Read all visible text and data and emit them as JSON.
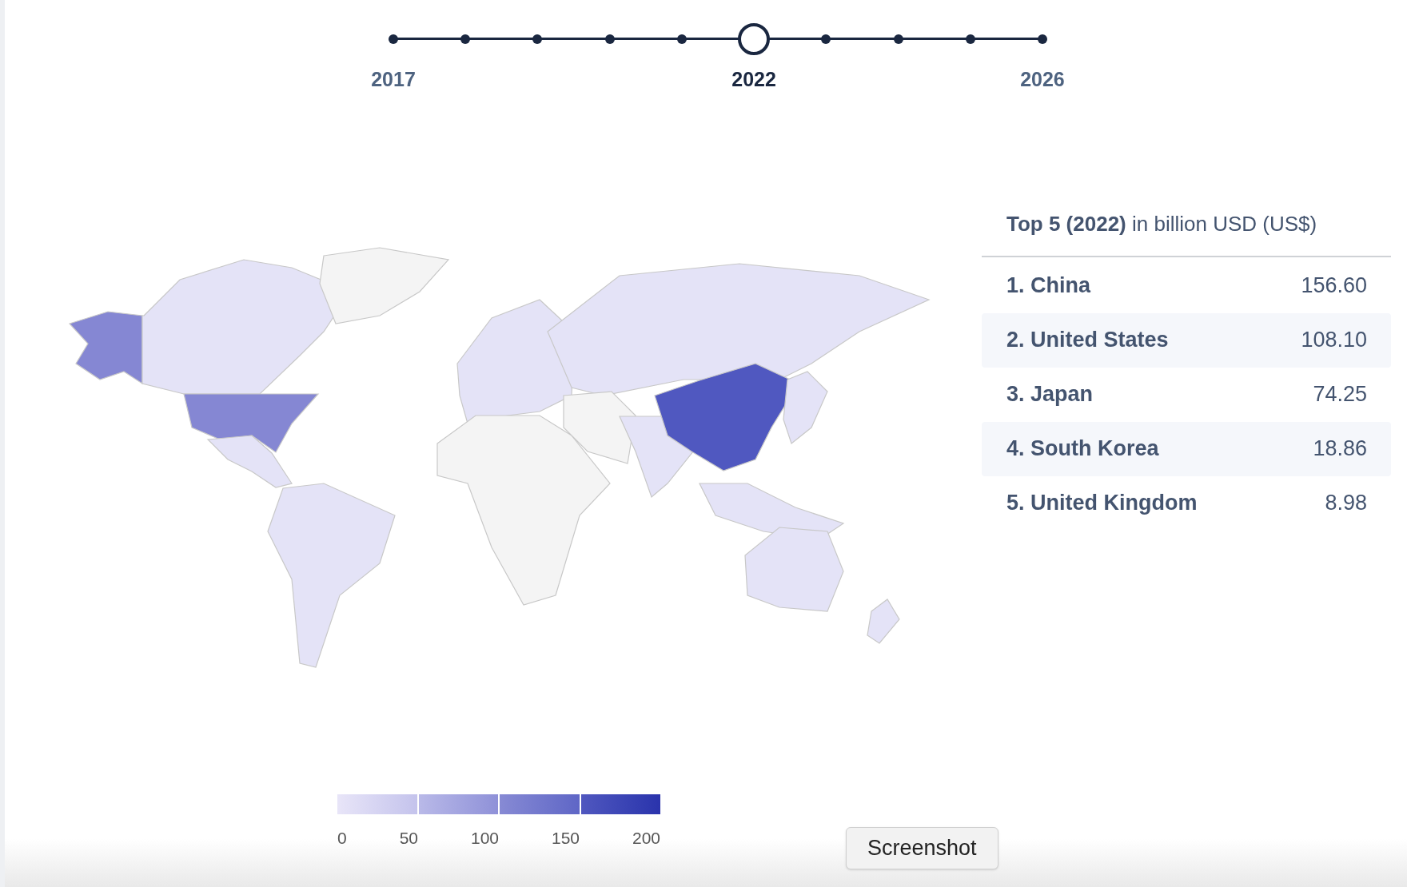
{
  "timeline": {
    "points": [
      {
        "label": "2017",
        "selected": false
      },
      {
        "selected": false
      },
      {
        "selected": false
      },
      {
        "selected": false
      },
      {
        "selected": false
      },
      {
        "label": "2022",
        "selected": true
      },
      {
        "selected": false
      },
      {
        "selected": false
      },
      {
        "selected": false
      },
      {
        "label": "2026",
        "selected": false
      }
    ]
  },
  "legend": {
    "ticks": [
      "0",
      "50",
      "100",
      "150",
      "200"
    ]
  },
  "top5": {
    "title": "**Top 5 (2022)** in billion USD (US$)",
    "rows": [
      {
        "name": "1. China",
        "value": "156.60"
      },
      {
        "name": "2. United States",
        "value": "108.10"
      },
      {
        "name": "3. Japan",
        "value": "74.25"
      },
      {
        "name": "4. South Korea",
        "value": "18.86"
      },
      {
        "name": "5. United Kingdom",
        "value": "8.98"
      }
    ]
  },
  "tooltip": {
    "text": "Screenshot"
  }
}
